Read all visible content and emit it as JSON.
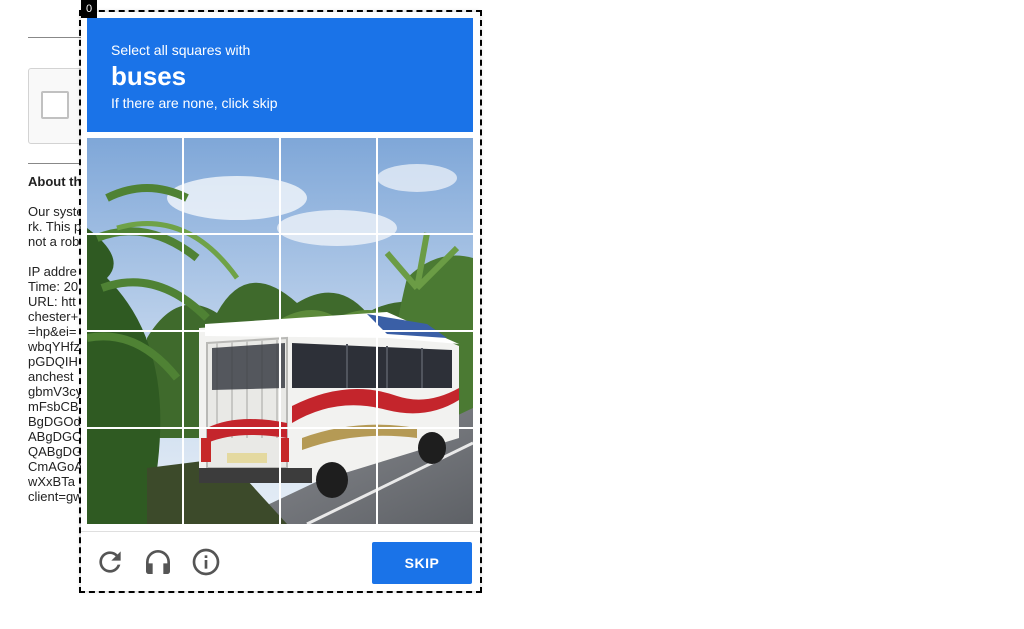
{
  "background_page": {
    "heading": "About th",
    "lines": [
      "Our syste",
      "rk. This p",
      "not a rob",
      "",
      "IP addre",
      "Time: 20",
      "URL: htt",
      "chester+",
      "=hp&ei=",
      "wbqYHfz",
      "pGDQIH",
      "anchest",
      "gbmV3cy",
      "mFsbCB",
      "BgDGOd",
      "ABgDGO",
      "QABgDG",
      "CmAGoA",
      "wXxBTa",
      "client=gw"
    ]
  },
  "counter": "0",
  "challenge": {
    "instruction": "Select all squares with",
    "target": "buses",
    "hint": "If there are none, click skip",
    "grid": {
      "rows": 4,
      "cols": 4,
      "selected_tiles": []
    }
  },
  "footer": {
    "reload_icon": "reload-icon",
    "audio_icon": "headphones-icon",
    "info_icon": "info-icon",
    "skip_label": "SKIP"
  },
  "colors": {
    "accent": "#1a73e8",
    "header_text": "#ffffff"
  }
}
